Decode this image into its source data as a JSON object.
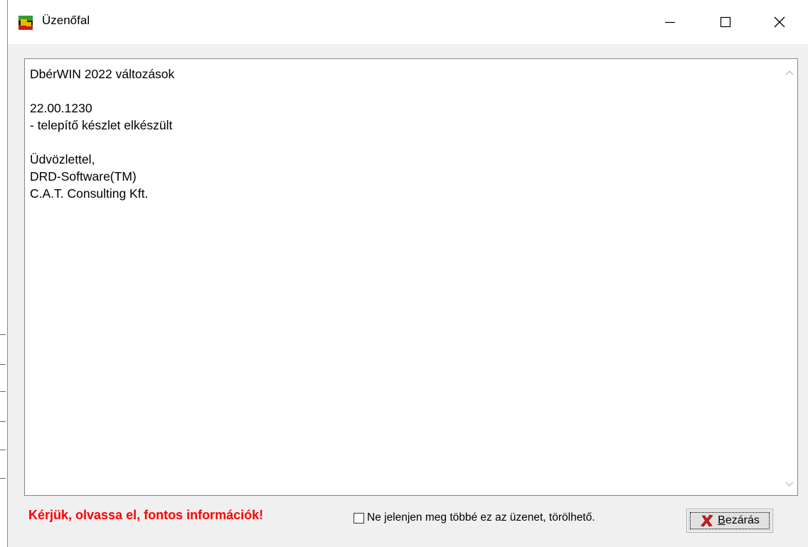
{
  "window": {
    "title": "Üzenőfal",
    "app_icon": "app-icon",
    "controls": [
      "minimize-icon",
      "maximize-icon",
      "close-icon"
    ]
  },
  "message": {
    "lines": [
      "DbérWIN 2022 változások",
      "",
      "22.00.1230",
      "- telepítő készlet elkészült",
      "",
      "Üdvözlettel,",
      "DRD-Software(TM)",
      "C.A.T. Consulting Kft."
    ]
  },
  "footer": {
    "warning_text": "Kérjük, olvassa el, fontos információk!",
    "warning_color": "#ff0000",
    "dont_show_label": "Ne jelenjen meg többé ez az üzenet, törölhető.",
    "dont_show_checked": false,
    "close_button": {
      "mnemonic": "B",
      "label_rest": "ezárás",
      "icon": "red-x-icon"
    }
  }
}
